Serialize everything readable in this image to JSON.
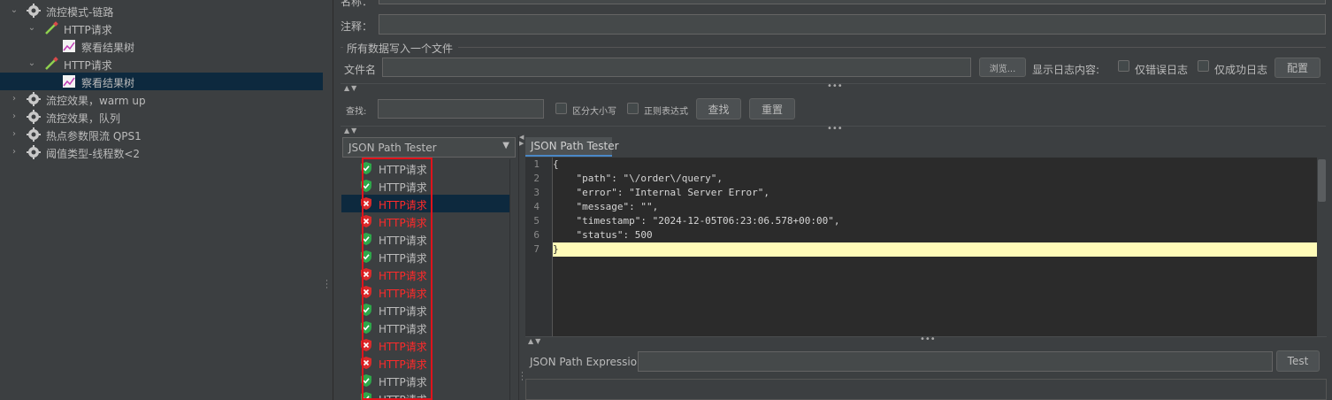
{
  "tree": {
    "items": [
      {
        "label": "流控模式-链路",
        "expanded": true
      },
      {
        "label": "HTTP请求",
        "expanded": true
      },
      {
        "label": "察看结果树"
      },
      {
        "label": "HTTP请求",
        "expanded": true
      },
      {
        "label": "察看结果树",
        "selected": true
      },
      {
        "label": "流控效果，warm up",
        "expanded": false
      },
      {
        "label": "流控效果，队列",
        "expanded": false
      },
      {
        "label": "热点参数限流 QPS1",
        "expanded": false
      },
      {
        "label": "阈值类型-线程数<2",
        "expanded": false
      }
    ]
  },
  "form": {
    "name_label": "名称：",
    "comment_label": "注释：",
    "file_section_title": "所有数据写入一个文件",
    "filename_label": "文件名",
    "browse_button": "浏览...",
    "log_content_label": "显示日志内容:",
    "errors_only_label": "仅错误日志",
    "success_only_label": "仅成功日志",
    "config_button": "配置"
  },
  "search": {
    "label": "查找:",
    "case_label": "区分大小写",
    "regex_label": "正则表达式",
    "find_button": "查找",
    "reset_button": "重置"
  },
  "renderer": {
    "selected": "JSON Path Tester"
  },
  "results": [
    {
      "label": "HTTP请求",
      "status": "success"
    },
    {
      "label": "HTTP请求",
      "status": "success"
    },
    {
      "label": "HTTP请求",
      "status": "error",
      "selected": true
    },
    {
      "label": "HTTP请求",
      "status": "error"
    },
    {
      "label": "HTTP请求",
      "status": "success"
    },
    {
      "label": "HTTP请求",
      "status": "success"
    },
    {
      "label": "HTTP请求",
      "status": "error"
    },
    {
      "label": "HTTP请求",
      "status": "error"
    },
    {
      "label": "HTTP请求",
      "status": "success"
    },
    {
      "label": "HTTP请求",
      "status": "success"
    },
    {
      "label": "HTTP请求",
      "status": "error"
    },
    {
      "label": "HTTP请求",
      "status": "error"
    },
    {
      "label": "HTTP请求",
      "status": "success"
    },
    {
      "label": "HTTP请求",
      "status": "success"
    }
  ],
  "tab": {
    "label": "JSON Path Tester"
  },
  "code": {
    "lines": [
      "{",
      "    \"path\": \"\\/order\\/query\",",
      "    \"error\": \"Internal Server Error\",",
      "    \"message\": \"\",",
      "    \"timestamp\": \"2024-12-05T06:23:06.578+00:00\",",
      "    \"status\": 500",
      "}"
    ],
    "line_numbers": [
      "1",
      "2",
      "3",
      "4",
      "5",
      "6",
      "7"
    ],
    "highlighted_line": 7
  },
  "json_path": {
    "label": "JSON Path Expression",
    "value": "",
    "test_button": "Test"
  },
  "colors": {
    "success": "#bbbbbb",
    "error": "#ff2a2a",
    "selection": "#0d293e",
    "highlight": "#fffbb8",
    "annotation_box": "#e0131b"
  }
}
